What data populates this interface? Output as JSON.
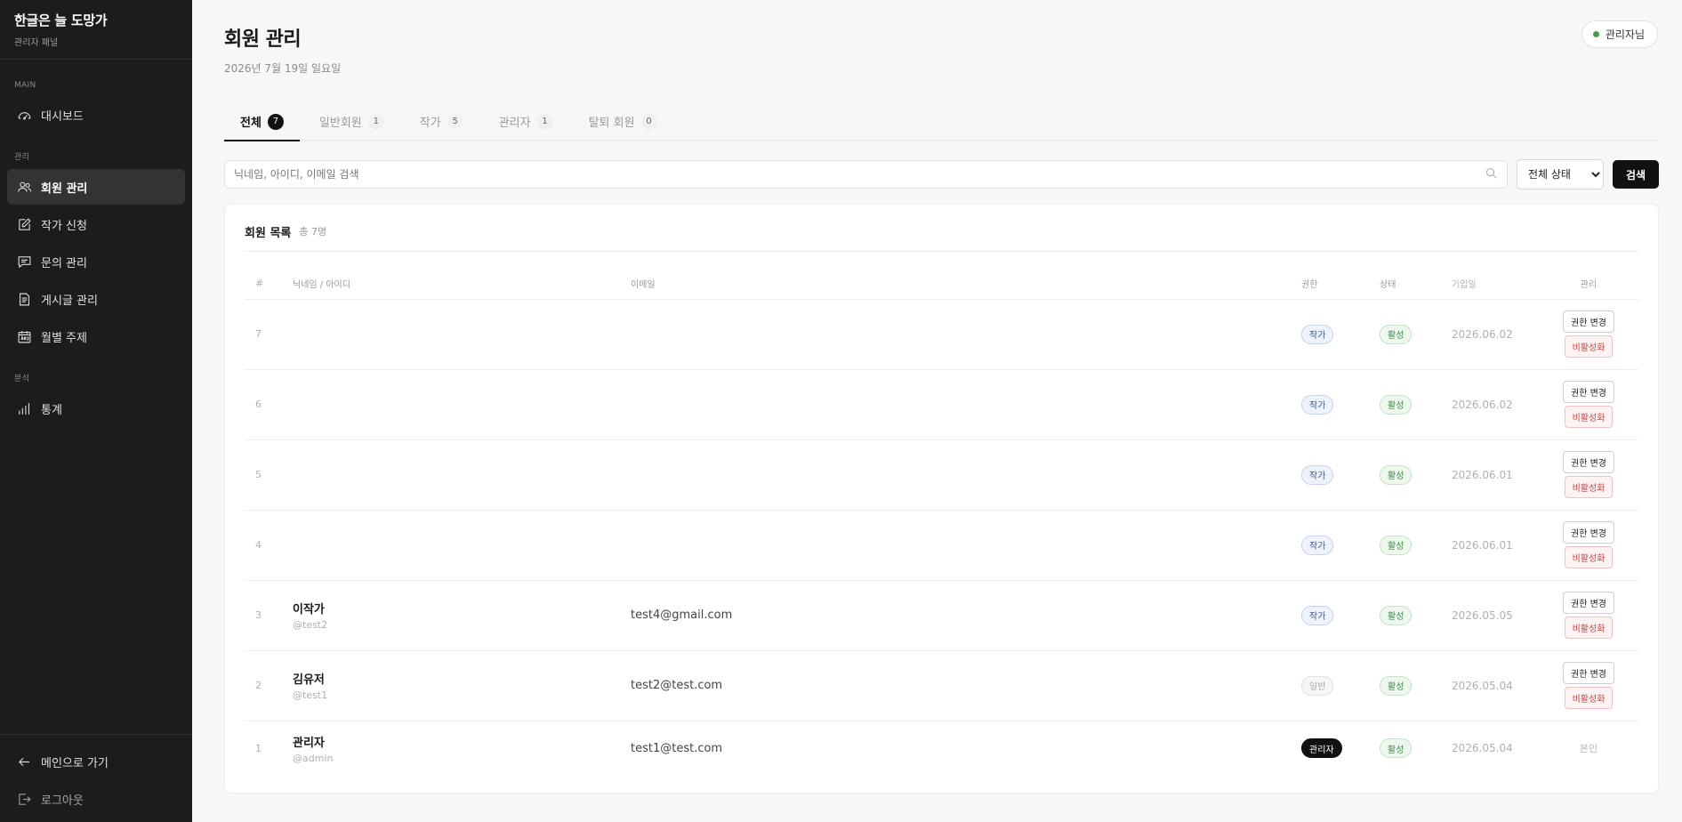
{
  "sidebar": {
    "brand_title": "한글은 늘 도망가",
    "brand_sub": "관리자 패널",
    "sections": [
      {
        "title": "MAIN",
        "items": [
          {
            "label": "대시보드",
            "icon": "dashboard-icon"
          }
        ]
      },
      {
        "title": "관리",
        "items": [
          {
            "label": "회원 관리",
            "icon": "users-icon",
            "active": true
          },
          {
            "label": "작가 신청",
            "icon": "edit-icon"
          },
          {
            "label": "문의 관리",
            "icon": "chat-icon"
          },
          {
            "label": "게시글 관리",
            "icon": "document-icon"
          },
          {
            "label": "월별 주제",
            "icon": "calendar-icon"
          }
        ]
      },
      {
        "title": "분석",
        "items": [
          {
            "label": "통계",
            "icon": "bar-chart-icon"
          }
        ]
      }
    ],
    "bottom": {
      "back_label": "메인으로 가기",
      "logout_label": "로그아웃"
    }
  },
  "header": {
    "title": "회원 관리",
    "date": "2026년 7월 19일 일요일",
    "user_label": "관리자님",
    "user_status_color": "#43a047"
  },
  "tabs": [
    {
      "label": "전체",
      "count": "7",
      "active": true
    },
    {
      "label": "일반회원",
      "count": "1"
    },
    {
      "label": "작가",
      "count": "5"
    },
    {
      "label": "관리자",
      "count": "1"
    },
    {
      "label": "탈퇴 회원",
      "count": "0"
    }
  ],
  "search": {
    "placeholder": "닉네임, 아이디, 이메일 검색",
    "value": "",
    "status_selected": "전체 상태",
    "button_label": "검색"
  },
  "list": {
    "title": "회원 목록",
    "total": "총 7명",
    "columns": {
      "idx": "#",
      "name": "닉네임 / 아이디",
      "email": "이메일",
      "role": "권한",
      "status": "상태",
      "joined": "가입일",
      "manage": "관리"
    },
    "change_role_label": "권한 변경",
    "deactivate_label": "비활성화",
    "self_label": "본인",
    "rows": [
      {
        "idx": "7",
        "nickname": "",
        "id": "",
        "email": "",
        "role": "작가",
        "role_type": "writer",
        "status": "활성",
        "joined": "2026.06.02"
      },
      {
        "idx": "6",
        "nickname": "",
        "id": "",
        "email": "",
        "role": "작가",
        "role_type": "writer",
        "status": "활성",
        "joined": "2026.06.02"
      },
      {
        "idx": "5",
        "nickname": "",
        "id": "",
        "email": "",
        "role": "작가",
        "role_type": "writer",
        "status": "활성",
        "joined": "2026.06.01"
      },
      {
        "idx": "4",
        "nickname": "",
        "id": "",
        "email": "",
        "role": "작가",
        "role_type": "writer",
        "status": "활성",
        "joined": "2026.06.01"
      },
      {
        "idx": "3",
        "nickname": "이작가",
        "id": "@test2",
        "email": "test4@gmail.com",
        "role": "작가",
        "role_type": "writer",
        "status": "활성",
        "joined": "2026.05.05"
      },
      {
        "idx": "2",
        "nickname": "김유저",
        "id": "@test1",
        "email": "test2@test.com",
        "role": "일반",
        "role_type": "general",
        "status": "활성",
        "joined": "2026.05.04"
      },
      {
        "idx": "1",
        "nickname": "관리자",
        "id": "@admin",
        "email": "test1@test.com",
        "role": "관리자",
        "role_type": "admin",
        "status": "활성",
        "joined": "2026.05.04",
        "is_self": true
      }
    ]
  }
}
